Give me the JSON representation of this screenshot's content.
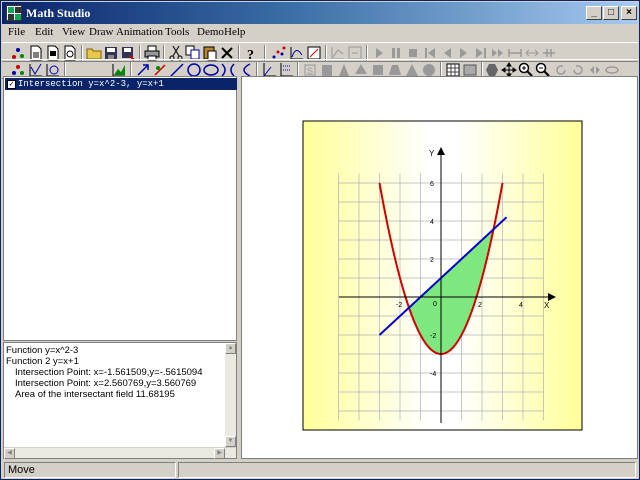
{
  "window": {
    "title": "Math Studio"
  },
  "menu": [
    "File",
    "Edit",
    "View",
    "Draw",
    "Animation",
    "Tools",
    "Demo",
    "Help"
  ],
  "tree": {
    "item_label": "Intersection  y=x^2-3, y=x+1",
    "checked": true
  },
  "info": {
    "lines": [
      "Function y=x^2-3",
      "Function 2 y=x+1",
      "Intersection Point: x=-1.561509,y=-.5615094",
      "Intersection Point: x=2.560769,y=3.560769",
      "Area of the intersectant field 11.68195"
    ]
  },
  "status": {
    "text": "Move"
  },
  "graph": {
    "x_axis_label": "X",
    "y_axis_label": "Y",
    "x_ticks": [
      "-2",
      "2",
      "4"
    ],
    "y_ticks": [
      "6",
      "4",
      "2",
      "-2",
      "-4"
    ],
    "origin_label": "0",
    "functions": [
      {
        "expr": "y=x^2-3",
        "color": "#cc0000"
      },
      {
        "expr": "y=x+1",
        "color": "#0000cc"
      }
    ],
    "fill_color": "#7ee87e",
    "background_gradient": [
      "#ffff99",
      "#ffffff"
    ]
  }
}
